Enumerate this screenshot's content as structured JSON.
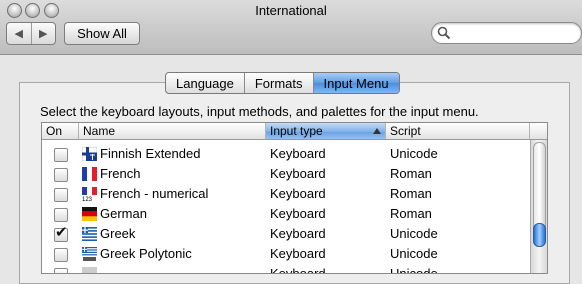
{
  "window": {
    "title": "International"
  },
  "toolbar": {
    "back_icon": "left-arrow-icon",
    "forward_icon": "right-arrow-icon",
    "show_all_label": "Show All",
    "search": {
      "value": "",
      "placeholder": ""
    }
  },
  "tabs": [
    {
      "label": "Language",
      "active": false
    },
    {
      "label": "Formats",
      "active": false
    },
    {
      "label": "Input Menu",
      "active": true
    }
  ],
  "panel": {
    "description": "Select the keyboard layouts, input methods, and palettes for the input menu."
  },
  "table": {
    "columns": [
      "On",
      "Name",
      "Input type",
      "Script"
    ],
    "sorted_column": "Input type",
    "rows": [
      {
        "on": false,
        "flag": "finland",
        "name": "Finnish Extended",
        "type": "Keyboard",
        "script": "Unicode"
      },
      {
        "on": false,
        "flag": "france",
        "name": "French",
        "type": "Keyboard",
        "script": "Roman"
      },
      {
        "on": false,
        "flag": "france-123",
        "name": "French - numerical",
        "type": "Keyboard",
        "script": "Roman"
      },
      {
        "on": false,
        "flag": "germany",
        "name": "German",
        "type": "Keyboard",
        "script": "Roman"
      },
      {
        "on": true,
        "flag": "greece",
        "name": "Greek",
        "type": "Keyboard",
        "script": "Unicode"
      },
      {
        "on": false,
        "flag": "greece-polytonic",
        "name": "Greek Polytonic",
        "type": "Keyboard",
        "script": "Unicode"
      },
      {
        "on": false,
        "flag": "partial",
        "name": "",
        "type": "Keyboard",
        "script": "Unicode"
      }
    ]
  },
  "colors": {
    "selected_blue": "#6aa2e6",
    "scroll_knob": "#2b6fd6"
  }
}
